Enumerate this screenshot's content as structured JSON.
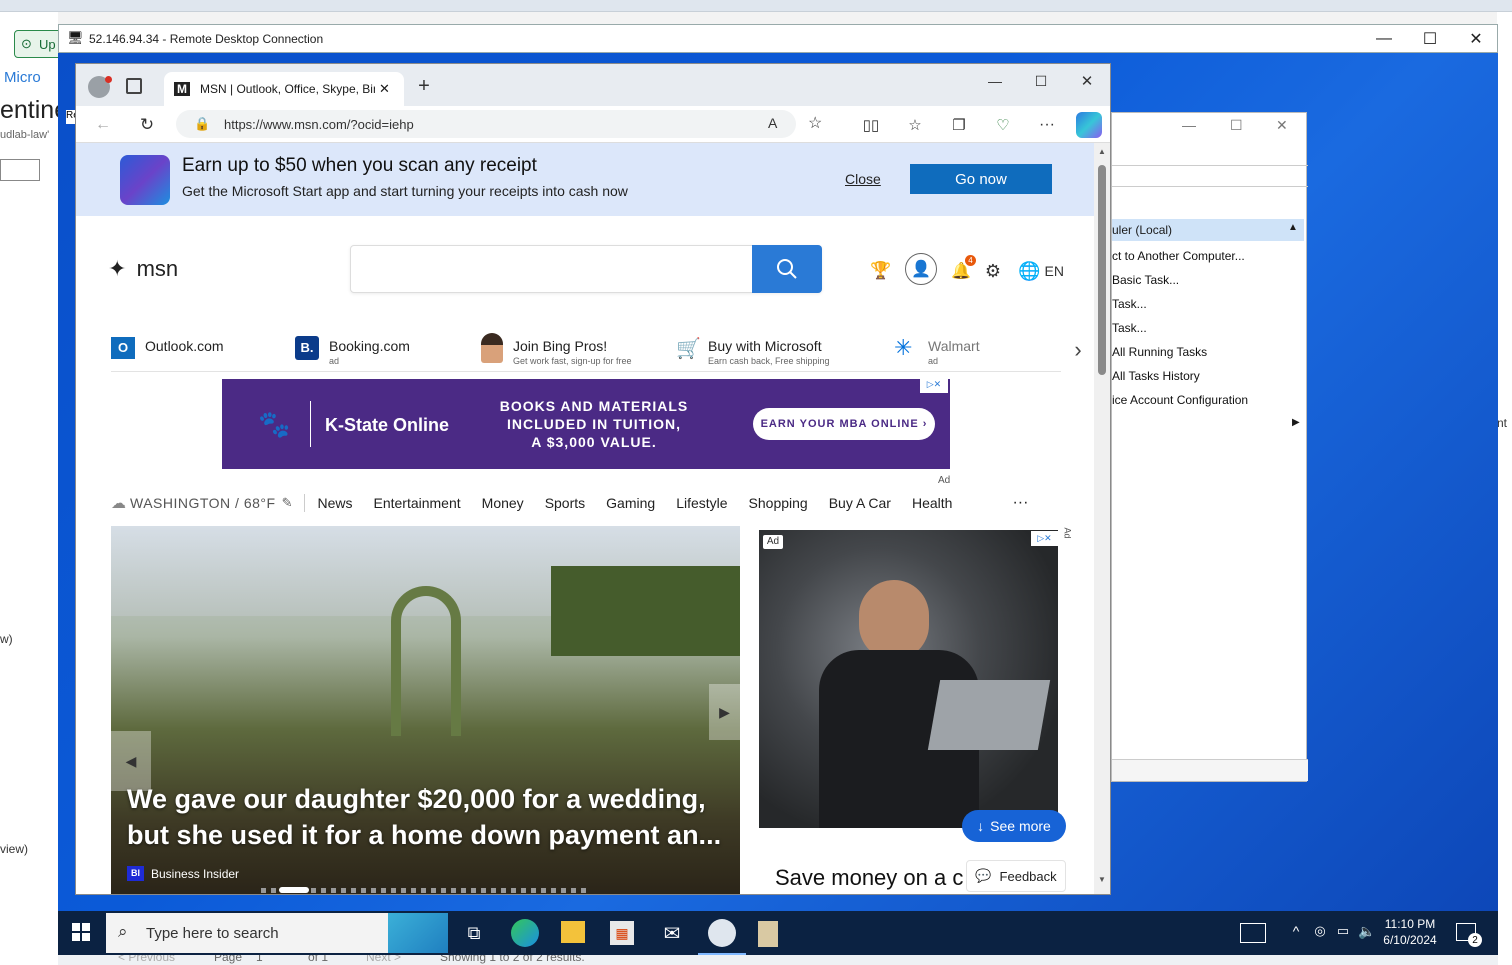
{
  "host": {
    "left_fragments": [
      "Up",
      "Micro",
      "entine",
      "udlab-law'",
      "Re",
      "w)",
      "view)"
    ],
    "bottom": {
      "prev": "< Previous",
      "page_label": "Page",
      "page_value": "1",
      "of": "of 1",
      "next": "Next >",
      "showing": "Showing 1 to 2 of 2 results."
    },
    "right_fragments": [
      "nt"
    ]
  },
  "rdp": {
    "title": "52.146.94.34 - Remote Desktop Connection"
  },
  "task_scheduler": {
    "items": [
      "uler (Local)",
      "ct to Another Computer...",
      "Basic Task...",
      "Task...",
      "Task...",
      "All Running Tasks",
      "All Tasks History",
      "ice Account Configuration"
    ]
  },
  "browser": {
    "tab_title": "MSN | Outlook, Office, Skype, Bing",
    "url": "https://www.msn.com/?ocid=iehp",
    "notification_count": "4",
    "language": "EN"
  },
  "banner": {
    "headline": "Earn up to $50 when you scan any receipt",
    "subtext": "Get the Microsoft Start app and start turning your receipts into cash now",
    "close_label": "Close",
    "go_label": "Go now"
  },
  "msn": {
    "logo": "msn"
  },
  "quick_links": [
    {
      "name": "Outlook.com",
      "sub": ""
    },
    {
      "name": "Booking.com",
      "sub": "ad"
    },
    {
      "name": "Join Bing Pros!",
      "sub": "Get work fast, sign-up for free"
    },
    {
      "name": "Buy with Microsoft",
      "sub": "Earn cash back, Free shipping"
    },
    {
      "name": "Walmart",
      "sub": "ad"
    }
  ],
  "ad": {
    "brand": "K-State Online",
    "line1": "BOOKS AND MATERIALS",
    "line2": "INCLUDED IN TUITION,",
    "line3": "A $3,000 VALUE.",
    "cta": "EARN YOUR MBA ONLINE ›",
    "ad_label": "Ad"
  },
  "nav": {
    "weather": "WASHINGTON / 68°F",
    "items": [
      "News",
      "Entertainment",
      "Money",
      "Sports",
      "Gaming",
      "Lifestyle",
      "Shopping",
      "Buy A Car",
      "Health"
    ],
    "more": "···"
  },
  "hero": {
    "headline_line1": "We gave our daughter $20,000 for a wedding,",
    "headline_line2": "but she used it for a home down payment an...",
    "source": "Business Insider",
    "source_badge": "BI"
  },
  "side_ad": {
    "ad_badge": "Ad",
    "ad_vertical": "Ad",
    "see_more": "See more",
    "headline": "Save money on a c",
    "feedback": "Feedback"
  },
  "taskbar": {
    "search_placeholder": "Type here to search",
    "time": "11:10 PM",
    "date": "6/10/2024",
    "notif_count": "2"
  }
}
